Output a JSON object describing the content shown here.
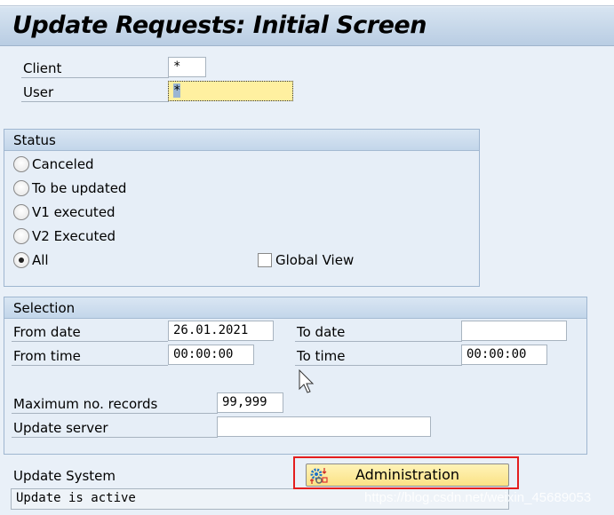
{
  "title": "Update Requests: Initial Screen",
  "client": {
    "label": "Client",
    "value": "*"
  },
  "user": {
    "label": "User",
    "value": "*"
  },
  "status": {
    "title": "Status",
    "options": [
      {
        "label": "Canceled",
        "selected": false
      },
      {
        "label": "To be updated",
        "selected": false
      },
      {
        "label": "V1 executed",
        "selected": false
      },
      {
        "label": "V2 Executed",
        "selected": false
      },
      {
        "label": "All",
        "selected": true
      }
    ],
    "global_view": {
      "label": "Global View",
      "checked": false
    }
  },
  "selection": {
    "title": "Selection",
    "from_date": {
      "label": "From date",
      "value": "26.01.2021"
    },
    "to_date": {
      "label": "To date",
      "value": ""
    },
    "from_time": {
      "label": "From time",
      "value": "00:00:00"
    },
    "to_time": {
      "label": "To time",
      "value": "00:00:00"
    },
    "max_records": {
      "label": "Maximum no. records",
      "value": "99,999"
    },
    "update_server": {
      "label": "Update server",
      "value": ""
    }
  },
  "update_system": {
    "label": "Update System",
    "value": "Update is active"
  },
  "administration_button": {
    "label": "Administration",
    "icon": "gears-icon",
    "highlight_color": "#e41e1e"
  },
  "watermark": "https://blog.csdn.net/weixin_45689053"
}
